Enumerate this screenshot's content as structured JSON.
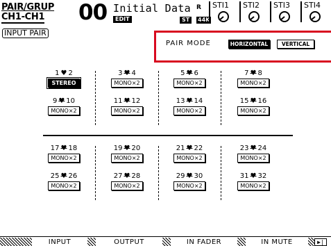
{
  "header": {
    "page_title_line1": "PAIR/GRUP",
    "page_title_line2": "CH1-CH1",
    "scene_number": "00",
    "scene_name": "Initial Data",
    "edit_badge": "EDIT",
    "protect_icon": "R",
    "st_badge": "ST",
    "rate_badge": "44K",
    "st_inputs": [
      {
        "label": "STI1",
        "icon": "knob-icon"
      },
      {
        "label": "STI2",
        "icon": "knob-icon"
      },
      {
        "label": "STI3",
        "icon": "knob-icon"
      },
      {
        "label": "STI4",
        "icon": "knob-icon"
      }
    ]
  },
  "panel": {
    "tag": "INPUT PAIR",
    "pair_mode_label": "PAIR MODE",
    "mode_horizontal": "HORIZONTAL",
    "mode_vertical": "VERTICAL",
    "selected_mode": "HORIZONTAL"
  },
  "pairs": [
    {
      "a": "1",
      "b": "2",
      "state": "STEREO",
      "linked": true
    },
    {
      "a": "3",
      "b": "4",
      "state": "MONO×2",
      "linked": false
    },
    {
      "a": "5",
      "b": "6",
      "state": "MONO×2",
      "linked": false
    },
    {
      "a": "7",
      "b": "8",
      "state": "MONO×2",
      "linked": false
    },
    {
      "a": "9",
      "b": "10",
      "state": "MONO×2",
      "linked": false
    },
    {
      "a": "11",
      "b": "12",
      "state": "MONO×2",
      "linked": false
    },
    {
      "a": "13",
      "b": "14",
      "state": "MONO×2",
      "linked": false
    },
    {
      "a": "15",
      "b": "16",
      "state": "MONO×2",
      "linked": false
    },
    {
      "a": "17",
      "b": "18",
      "state": "MONO×2",
      "linked": false
    },
    {
      "a": "19",
      "b": "20",
      "state": "MONO×2",
      "linked": false
    },
    {
      "a": "21",
      "b": "22",
      "state": "MONO×2",
      "linked": false
    },
    {
      "a": "23",
      "b": "24",
      "state": "MONO×2",
      "linked": false
    },
    {
      "a": "25",
      "b": "26",
      "state": "MONO×2",
      "linked": false
    },
    {
      "a": "27",
      "b": "28",
      "state": "MONO×2",
      "linked": false
    },
    {
      "a": "29",
      "b": "30",
      "state": "MONO×2",
      "linked": false
    },
    {
      "a": "31",
      "b": "32",
      "state": "MONO×2",
      "linked": false
    }
  ],
  "tabs": [
    {
      "label": "INPUT",
      "active": true
    },
    {
      "label": "OUTPUT",
      "active": false
    },
    {
      "label": "IN FADER",
      "active": false
    },
    {
      "label": "IN MUTE",
      "active": false
    }
  ],
  "next_tab_icon": "next-page-icon",
  "colors": {
    "highlight_border": "#d8091f",
    "ink": "#000000",
    "paper": "#ffffff"
  }
}
